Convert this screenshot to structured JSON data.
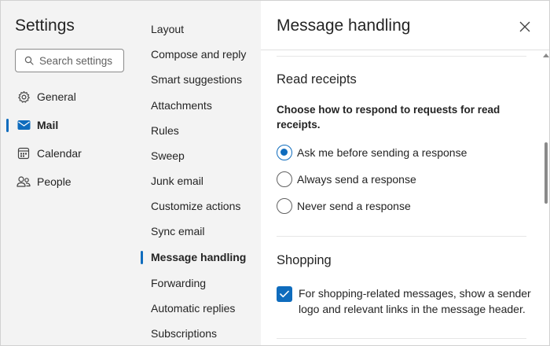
{
  "settings_pane": {
    "title": "Settings",
    "search": {
      "placeholder": "Search settings",
      "icon": "search-icon"
    },
    "nav": [
      {
        "label": "General",
        "icon": "gear-icon",
        "selected": false
      },
      {
        "label": "Mail",
        "icon": "mail-icon",
        "selected": true
      },
      {
        "label": "Calendar",
        "icon": "calendar-icon",
        "selected": false
      },
      {
        "label": "People",
        "icon": "people-icon",
        "selected": false
      }
    ]
  },
  "mail_settings_menu": {
    "items": [
      "Layout",
      "Compose and reply",
      "Smart suggestions",
      "Attachments",
      "Rules",
      "Sweep",
      "Junk email",
      "Customize actions",
      "Sync email",
      "Message handling",
      "Forwarding",
      "Automatic replies",
      "Subscriptions"
    ],
    "selected": "Message handling"
  },
  "content": {
    "title": "Message handling",
    "close_icon": "close-icon",
    "read_receipts": {
      "heading": "Read receipts",
      "description": "Choose how to respond to requests for read receipts.",
      "options": [
        {
          "label": "Ask me before sending a response",
          "checked": true
        },
        {
          "label": "Always send a response",
          "checked": false
        },
        {
          "label": "Never send a response",
          "checked": false
        }
      ]
    },
    "shopping": {
      "heading": "Shopping",
      "checkbox_label": "For shopping-related messages, show a sender logo and relevant links in the message header.",
      "checked": true
    }
  },
  "colors": {
    "accent": "#0f6cbd",
    "pane_background": "#f3f3f3",
    "text": "#242424"
  }
}
